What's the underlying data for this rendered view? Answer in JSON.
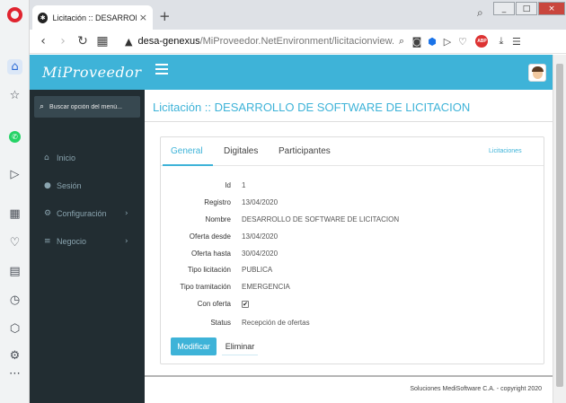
{
  "browser": {
    "tab_title": "Licitación :: DESARROLLO D",
    "tab_close": "×",
    "new_tab": "+",
    "url_host": "desa-genexus",
    "url_path": "/MiProveedor.NetEnvironment/licitacionview.aspx",
    "abp_label": "ABP",
    "window_min": "_",
    "window_max": "□",
    "window_close": "×"
  },
  "app": {
    "brand": "MiProveedor"
  },
  "sidebar": {
    "search_placeholder": "Buscar opción del menú...",
    "items": [
      {
        "label": "Inicio",
        "icon": "home-icon",
        "glyph": "⌂"
      },
      {
        "label": "Sesión",
        "icon": "user-icon",
        "glyph": "●"
      },
      {
        "label": "Configuración",
        "icon": "gear-icon",
        "glyph": "⚙",
        "chevron": "›"
      },
      {
        "label": "Negocio",
        "icon": "list-icon",
        "glyph": "≡",
        "chevron": "›"
      }
    ]
  },
  "page": {
    "title": "Licitación :: DESARROLLO DE SOFTWARE DE LICITACION"
  },
  "tabs": {
    "items": [
      "General",
      "Digitales",
      "Participantes"
    ],
    "active": "General",
    "link": "Licitaciones"
  },
  "fields": [
    {
      "label": "Id",
      "value": "1"
    },
    {
      "label": "Registro",
      "value": "13/04/2020"
    },
    {
      "label": "Nombre",
      "value": "DESARROLLO DE SOFTWARE DE LICITACION"
    },
    {
      "label": "Oferta desde",
      "value": "13/04/2020"
    },
    {
      "label": "Oferta hasta",
      "value": "30/04/2020"
    },
    {
      "label": "Tipo licitación",
      "value": "PUBLICA"
    },
    {
      "label": "Tipo tramitación",
      "value": "EMERGENCIA"
    },
    {
      "label": "Con oferta",
      "value": "✔"
    },
    {
      "label": "Status",
      "value": "Recepción de ofertas"
    }
  ],
  "buttons": {
    "modify": "Modificar",
    "delete": "Eliminar"
  },
  "footer": {
    "text": "Soluciones MediSoftware C.A. - copyright 2020"
  },
  "colors": {
    "accent": "#3eb3d8",
    "sidebar": "#222d32"
  }
}
